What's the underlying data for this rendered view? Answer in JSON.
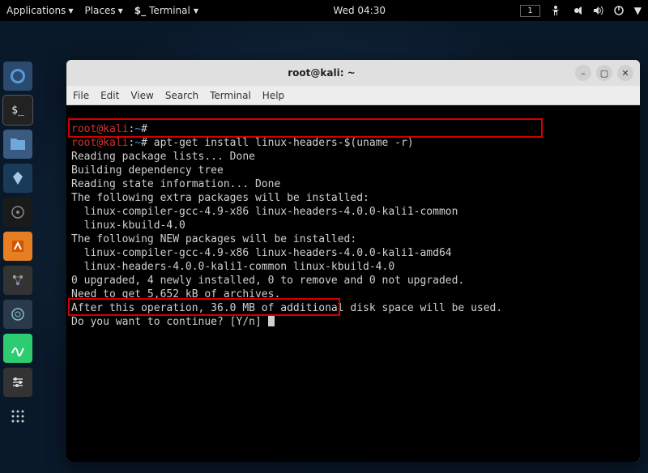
{
  "top_panel": {
    "applications": "Applications",
    "places": "Places",
    "terminal_label": "Terminal",
    "clock": "Wed 04:30",
    "workspace": "1"
  },
  "window": {
    "title": "root@kali: ~"
  },
  "menubar": {
    "file": "File",
    "edit": "Edit",
    "view": "View",
    "search": "Search",
    "terminal": "Terminal",
    "help": "Help"
  },
  "terminal": {
    "prompt_user": "root",
    "prompt_at": "@",
    "prompt_host": "kali",
    "prompt_sep": ":",
    "prompt_path": "~",
    "prompt_hash": "#",
    "line0_cmd": "",
    "line1_cmd": " apt-get install linux-headers-$(uname -r)",
    "out1": "Reading package lists... Done",
    "out2": "Building dependency tree",
    "out3": "Reading state information... Done",
    "out4": "The following extra packages will be installed:",
    "out5": "  linux-compiler-gcc-4.9-x86 linux-headers-4.0.0-kali1-common",
    "out6": "  linux-kbuild-4.0",
    "out7": "The following NEW packages will be installed:",
    "out8": "  linux-compiler-gcc-4.9-x86 linux-headers-4.0.0-kali1-amd64",
    "out9": "  linux-headers-4.0.0-kali1-common linux-kbuild-4.0",
    "out10": "0 upgraded, 4 newly installed, 0 to remove and 0 not upgraded.",
    "out11": "Need to get 5,652 kB of archives.",
    "out12": "After this operation, 36.0 MB of additional disk space will be used.",
    "out13": "Do you want to continue? [Y/n] "
  }
}
